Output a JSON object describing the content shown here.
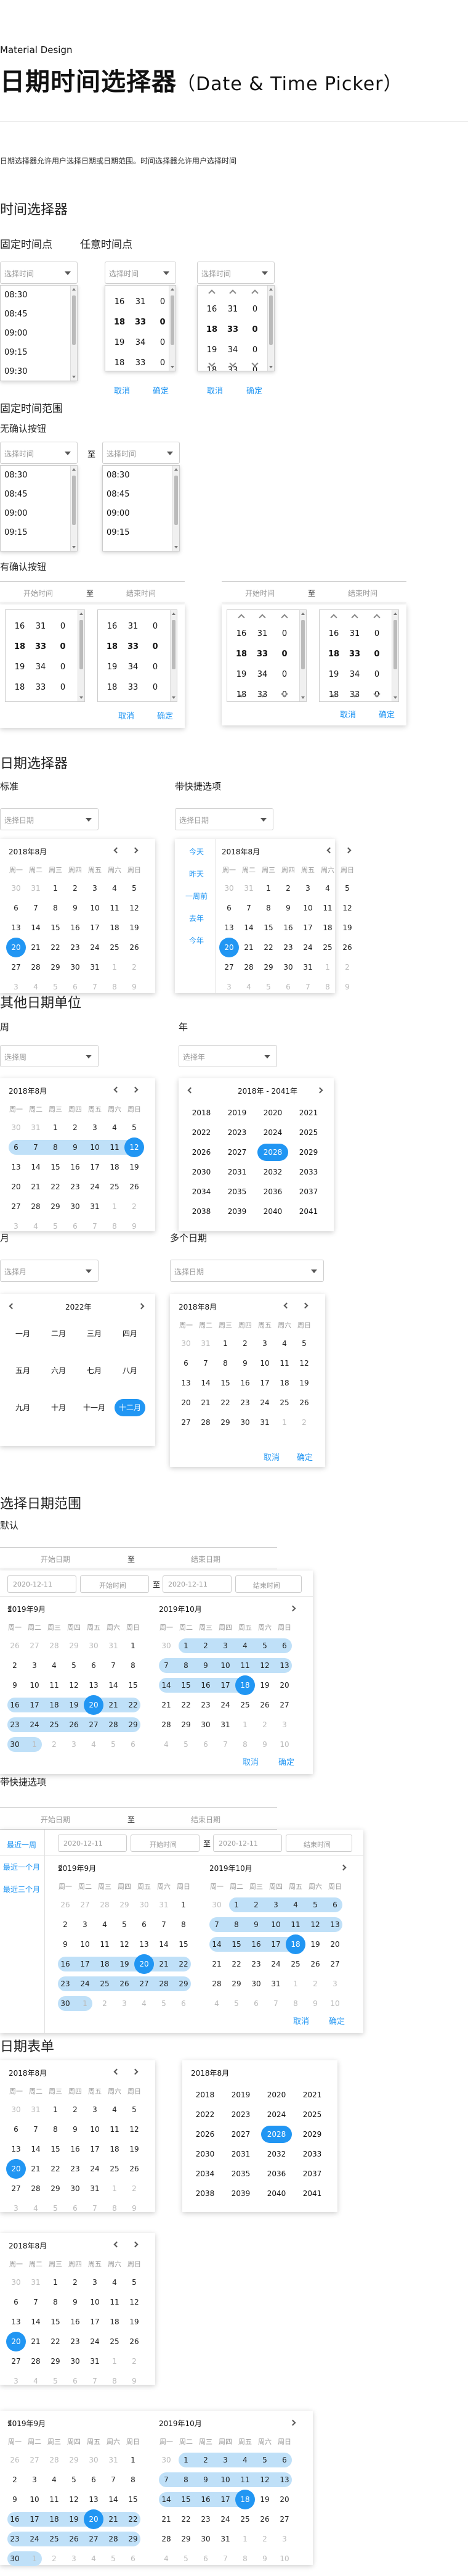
{
  "header": {
    "subtitle": "Material Design",
    "title": "日期时间选择器",
    "title_en": "（Date & Time Picker）",
    "description": "日期选择器允许用户选择日期或日期范围。时间选择器允许用户选择时间"
  },
  "time_section": {
    "title": "时间选择器",
    "fixed_label": "固定时间点",
    "any_label": "任意时间点",
    "placeholder": "选择时间",
    "fixed_items": [
      "08:30",
      "08:45",
      "09:00",
      "09:15",
      "09:30"
    ],
    "spin_rows": [
      [
        "16",
        "31",
        "0"
      ],
      [
        "18",
        "33",
        "0"
      ],
      [
        "19",
        "34",
        "0"
      ],
      [
        "18",
        "33",
        "0"
      ]
    ],
    "cancel": "取消",
    "confirm": "确定",
    "range_title": "固定时间范围",
    "no_confirm_label": "无确认按钮",
    "to": "至",
    "range_items": [
      "08:30",
      "08:45",
      "09:00",
      "09:15"
    ],
    "with_confirm_label": "有确认按钮",
    "start_time": "开始时间",
    "end_time": "结束时间"
  },
  "date_section": {
    "title": "日期选择器",
    "standard_label": "标准",
    "shortcut_label": "带快捷选项",
    "placeholder": "选择日期",
    "month_label": "2018年8月",
    "weekdays": [
      "周一",
      "周二",
      "周三",
      "周四",
      "周五",
      "周六",
      "周日"
    ],
    "shortcuts": [
      "今天",
      "昨天",
      "一周前",
      "去年",
      "今年"
    ]
  },
  "other_unit": {
    "title": "其他日期单位",
    "week_label": "周",
    "week_placeholder": "选择周",
    "year_label": "年",
    "year_placeholder": "选择年",
    "year_range": "2018年 - 2041年",
    "years": [
      "2018",
      "2019",
      "2020",
      "2021",
      "2022",
      "2023",
      "2024",
      "2025",
      "2026",
      "2027",
      "2028",
      "2029",
      "2030",
      "2031",
      "2032",
      "2033",
      "2034",
      "2035",
      "2036",
      "2037",
      "2038",
      "2039",
      "2040",
      "2041"
    ],
    "month_label": "月",
    "month_placeholder": "选择月",
    "year_2022": "2022年",
    "months": [
      "一月",
      "二月",
      "三月",
      "四月",
      "五月",
      "六月",
      "七月",
      "八月",
      "九月",
      "十月",
      "十一月",
      "十二月"
    ],
    "multi_label": "多个日期",
    "multi_placeholder": "选择日期"
  },
  "range_section": {
    "title": "选择日期范围",
    "default_label": "默认",
    "start_date": "开始日期",
    "end_date": "结束日期",
    "to": "至",
    "date_value": "2020-12-11",
    "start_time": "开始时间",
    "end_time": "结束时间",
    "month_left": "2019年9月",
    "month_right": "2019年10月",
    "shortcut_label": "带快捷选项",
    "shortcuts": [
      "最近一周",
      "最近一个月",
      "最近三个月"
    ]
  },
  "table_section": {
    "title": "日期表单",
    "month_label": "2018年8月",
    "year_range_label": "2018年8月",
    "month_left": "2019年9月",
    "month_right": "2019年10月"
  },
  "colors": {
    "accent": "#2196f3",
    "range": "#bfe0f8"
  }
}
